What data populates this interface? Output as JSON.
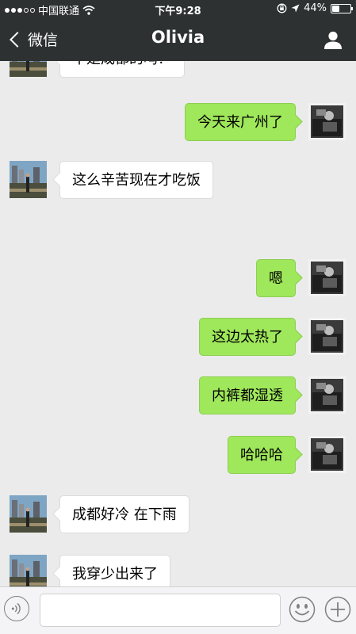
{
  "status_bar": {
    "carrier": "中国联通",
    "time": "下午9:28",
    "battery": "44%",
    "battery_level": 0.44,
    "icons": [
      "signal-dots",
      "wifi-icon",
      "rotation-lock-icon",
      "location-arrow-icon",
      "battery-icon"
    ]
  },
  "nav": {
    "back_label": "微信",
    "title": "Olivia",
    "right_icon": "person-icon"
  },
  "messages": [
    {
      "side": "left",
      "text": "不是成都的吗？"
    },
    {
      "side": "right",
      "text": "今天来广州了"
    },
    {
      "side": "left",
      "text": "这么辛苦现在才吃饭"
    },
    {
      "side": "right",
      "text": "嗯"
    },
    {
      "side": "right",
      "text": "这边太热了"
    },
    {
      "side": "right",
      "text": "内裤都湿透"
    },
    {
      "side": "right",
      "text": "哈哈哈"
    },
    {
      "side": "left",
      "text": "成都好冷 在下雨"
    },
    {
      "side": "left",
      "text": "我穿少出来了"
    }
  ],
  "input_bar": {
    "value": "",
    "icons": [
      "voice-icon",
      "emoji-icon",
      "plus-icon"
    ]
  },
  "colors": {
    "header_bg": "#2e3132",
    "chat_bg": "#ebebeb",
    "outgoing_bubble": "#9fe75b",
    "incoming_bubble": "#ffffff"
  }
}
